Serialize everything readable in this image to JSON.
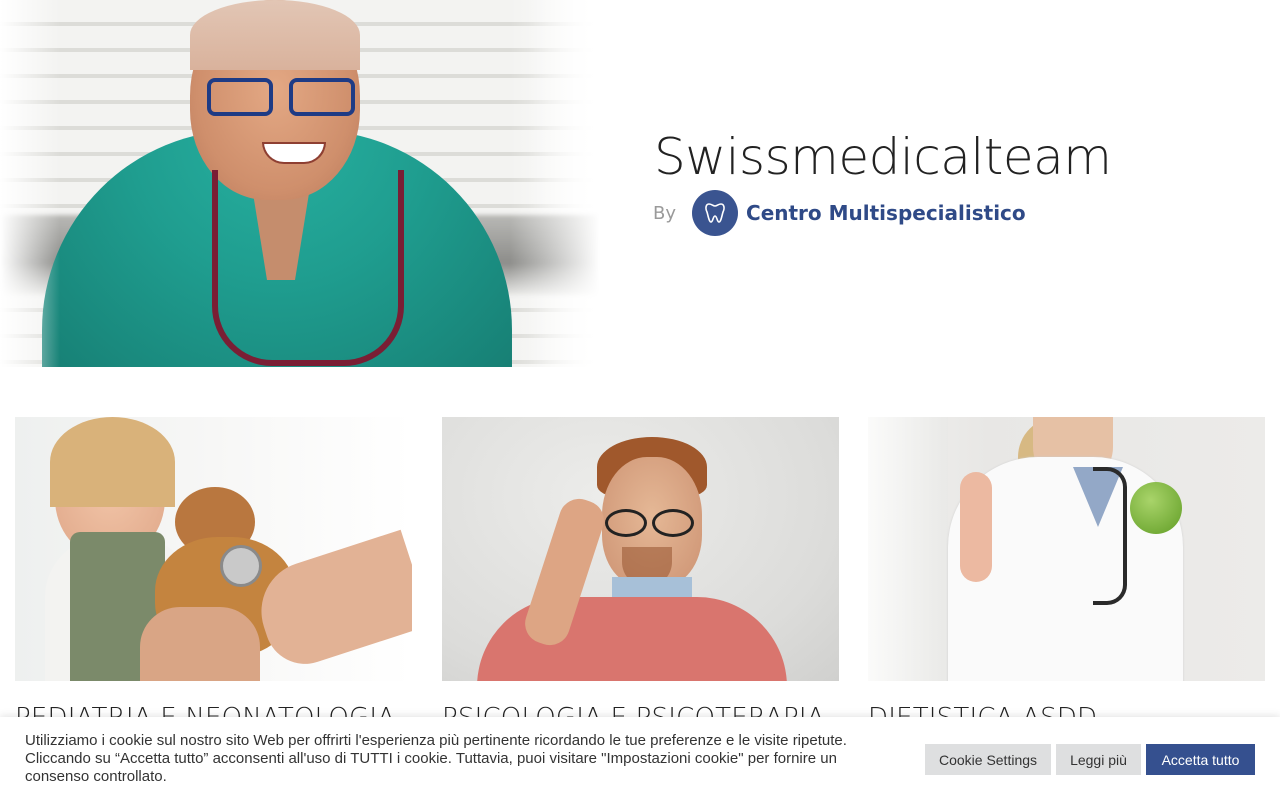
{
  "hero": {
    "title": "Swissmedicalteam",
    "by_label": "By",
    "author_name": "Centro Multispecialistico"
  },
  "cards": [
    {
      "title": "PEDIATRIA E NEONATOLOGIA"
    },
    {
      "title": "PSICOLOGIA E PSICOTERAPIA"
    },
    {
      "title": "DIETISTICA ASDD"
    }
  ],
  "cookie": {
    "message": "Utilizziamo i cookie sul nostro sito Web per offrirti l'esperienza più pertinente ricordando le tue preferenze e le visite ripetute. Cliccando su “Accetta tutto” acconsenti all'uso di TUTTI i cookie. Tuttavia, puoi visitare \"Impostazioni cookie\" per fornire un consenso controllato.",
    "settings_label": "Cookie Settings",
    "read_more_label": "Leggi più",
    "accept_label": "Accetta tutto"
  },
  "colors": {
    "brand": "#35508f",
    "author_link": "#2f4a87"
  }
}
